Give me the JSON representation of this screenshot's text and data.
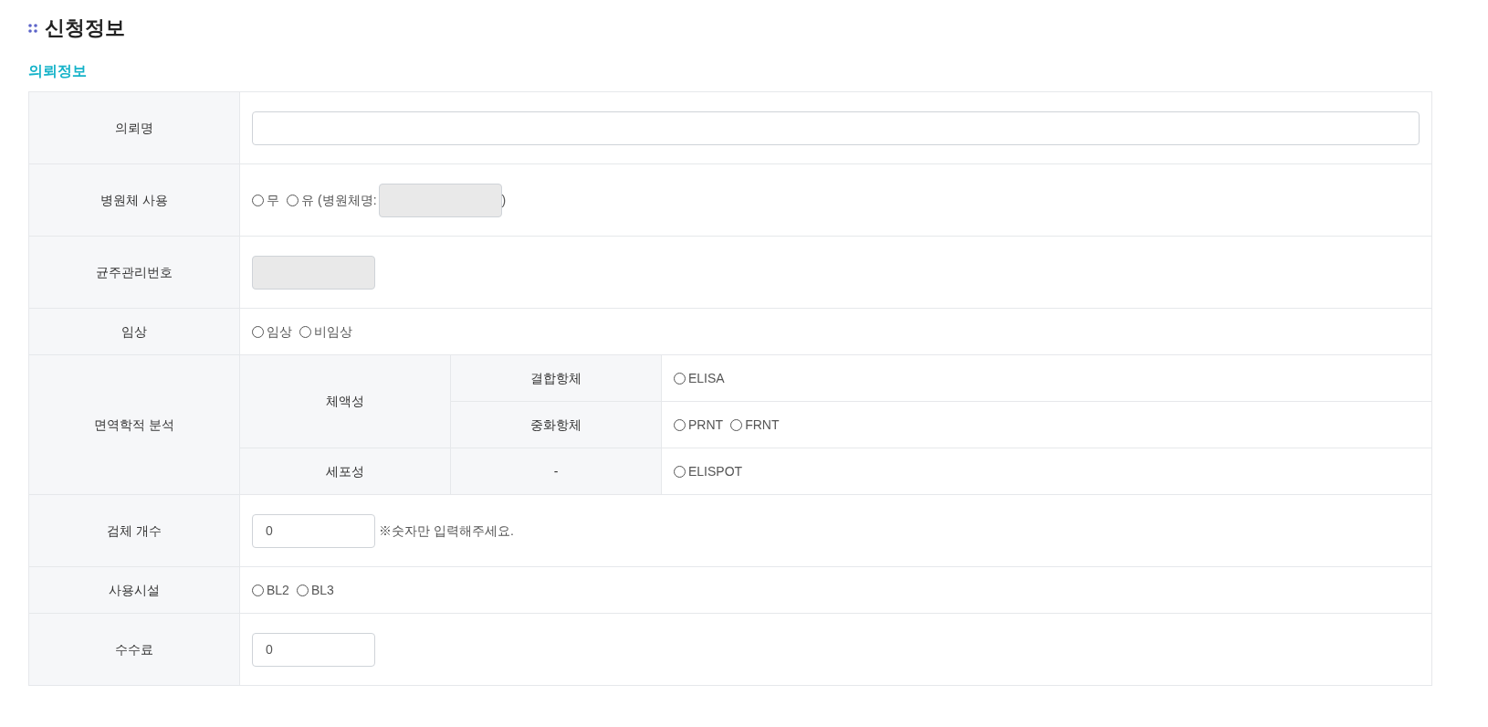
{
  "title": "신청정보",
  "section": "의뢰정보",
  "rows": [
    {
      "kind": "text",
      "label": "의뢰명",
      "disabled": false
    },
    {
      "kind": "radio",
      "label": "병원체 사용",
      "options": [
        {
          "label": "무",
          "selected": false
        },
        {
          "label": "유",
          "selected": false
        }
      ],
      "extra": {
        "prefix": "(병원체명:",
        "disabled": true,
        "suffix": ")"
      }
    },
    {
      "kind": "short",
      "label": "균주관리번호",
      "disabled": true
    },
    {
      "kind": "radio",
      "label": "임상",
      "options": [
        {
          "label": "임상",
          "selected": false
        },
        {
          "label": "비임상",
          "selected": false
        }
      ]
    },
    {
      "kind": "matrix",
      "label": "면역학적 분석",
      "groups": [
        {
          "label": "체액성",
          "subrows": [
            {
              "label": "결합항체",
              "options": [
                {
                  "label": "ELISA",
                  "selected": false
                }
              ]
            },
            {
              "label": "중화항체",
              "options": [
                {
                  "label": "PRNT",
                  "selected": false
                },
                {
                  "label": "FRNT",
                  "selected": false
                }
              ]
            }
          ]
        },
        {
          "label": "세포성",
          "subrows": [
            {
              "label": "-",
              "options": [
                {
                  "label": "ELISPOT",
                  "selected": false
                }
              ]
            }
          ]
        }
      ]
    },
    {
      "kind": "short",
      "label": "검체 개수",
      "value": "0",
      "disabled": false,
      "note": "※숫자만 입력해주세요."
    },
    {
      "kind": "radio",
      "label": "사용시설",
      "options": [
        {
          "label": "BL2",
          "selected": false
        },
        {
          "label": "BL3",
          "selected": false
        }
      ]
    },
    {
      "kind": "short",
      "label": "수수료",
      "value": "0",
      "disabled": false
    }
  ]
}
